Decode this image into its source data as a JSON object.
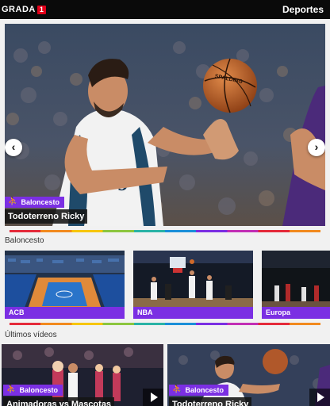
{
  "header": {
    "logo_text": "GRADA",
    "logo_badge": "1",
    "section": "Deportes"
  },
  "hero": {
    "tag": "Baloncesto",
    "title": "Todoterreno Ricky",
    "jersey_number": "9",
    "ball_text": "SPALDING",
    "tag_icon": "basketball-player-icon"
  },
  "categories": {
    "heading": "Baloncesto",
    "items": [
      {
        "label": "ACB"
      },
      {
        "label": "NBA"
      },
      {
        "label": "Europa"
      }
    ]
  },
  "videos": {
    "heading": "Últimos vídeos",
    "items": [
      {
        "tag": "Baloncesto",
        "title": "Animadoras vs Mascotas"
      },
      {
        "tag": "Baloncesto",
        "title": "Todoterreno Ricky"
      }
    ]
  },
  "colors": {
    "accent": "#7b2fe3",
    "brand": "#e2001a",
    "topbar": "#0a0a0a"
  }
}
